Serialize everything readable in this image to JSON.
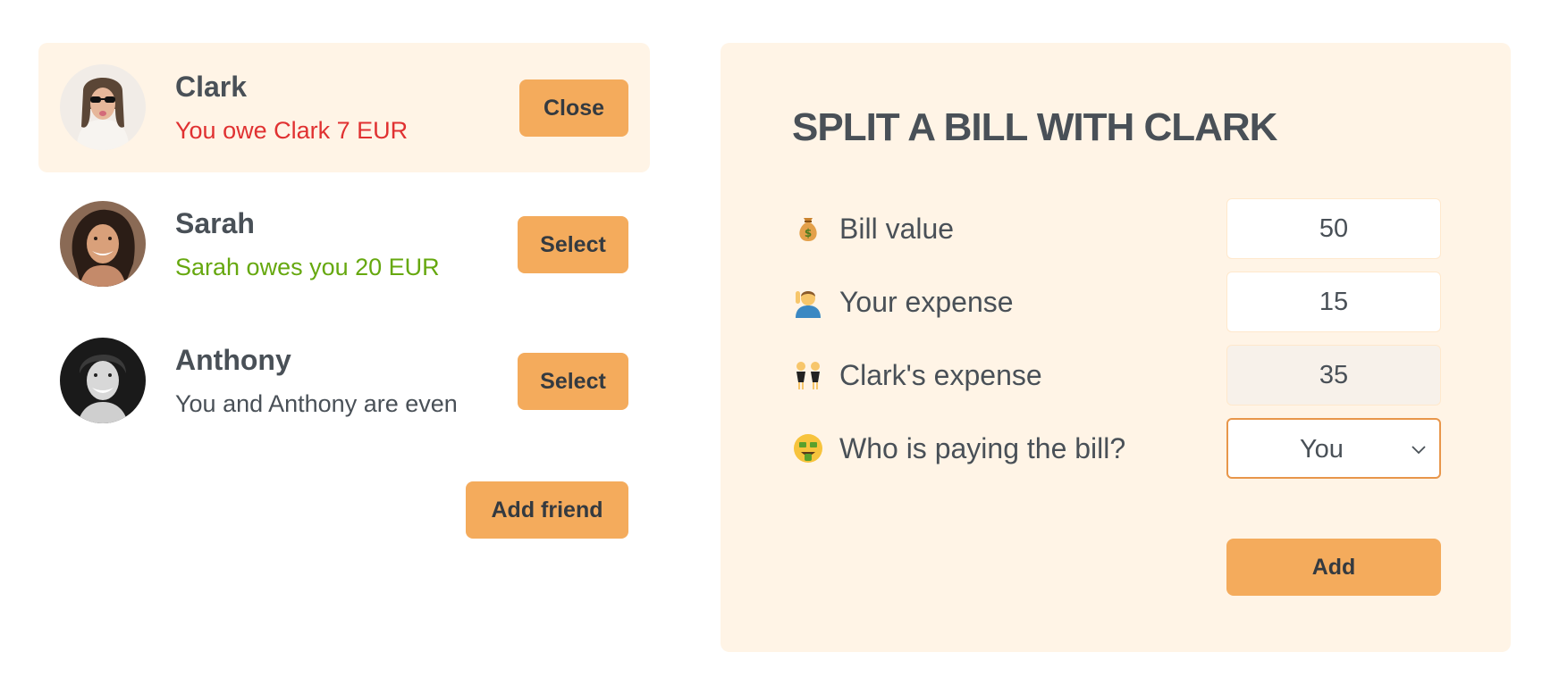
{
  "friends": [
    {
      "name": "Clark",
      "status": "You owe Clark 7 EUR",
      "status_tone": "negative",
      "button": "Close",
      "selected": true
    },
    {
      "name": "Sarah",
      "status": "Sarah owes you 20 EUR",
      "status_tone": "positive",
      "button": "Select",
      "selected": false
    },
    {
      "name": "Anthony",
      "status": "You and Anthony are even",
      "status_tone": "even",
      "button": "Select",
      "selected": false
    }
  ],
  "add_friend_label": "Add friend",
  "split_form": {
    "title": "SPLIT A BILL WITH CLARK",
    "bill_value": {
      "label": "Bill value",
      "icon": "money-bag-icon",
      "value": "50"
    },
    "your_expense": {
      "label": "Your expense",
      "icon": "person-raising-hand-icon",
      "value": "15"
    },
    "friend_expense": {
      "label": "Clark's expense",
      "icon": "two-people-icon",
      "value": "35"
    },
    "payer": {
      "label": "Who is paying the bill?",
      "icon": "money-mouth-face-icon",
      "selected": "You"
    },
    "submit_label": "Add"
  },
  "colors": {
    "accent": "#f4ab5c",
    "panel_bg": "#fff4e6",
    "negative": "#e03131",
    "positive": "#66a80f",
    "text": "#495057"
  }
}
